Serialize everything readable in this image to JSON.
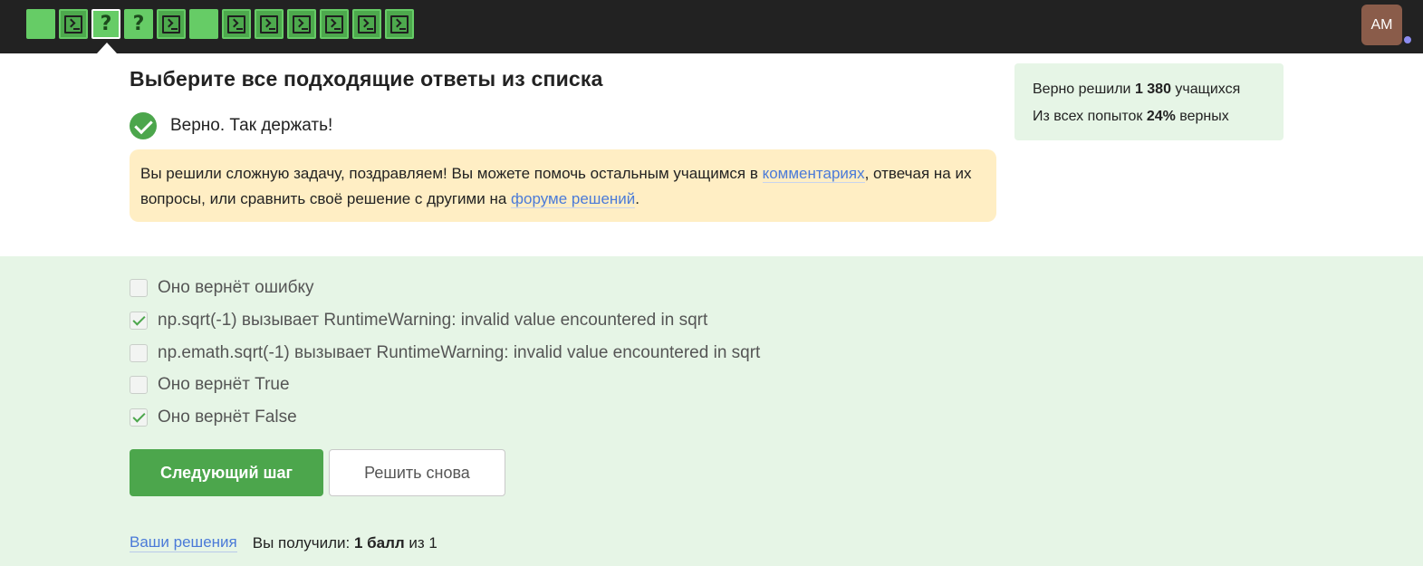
{
  "steps": [
    {
      "kind": "blank"
    },
    {
      "kind": "code"
    },
    {
      "kind": "quiz",
      "glyph": "?",
      "current": true
    },
    {
      "kind": "quiz",
      "glyph": "?"
    },
    {
      "kind": "code"
    },
    {
      "kind": "blank"
    },
    {
      "kind": "code"
    },
    {
      "kind": "code"
    },
    {
      "kind": "code"
    },
    {
      "kind": "code"
    },
    {
      "kind": "code"
    },
    {
      "kind": "code"
    }
  ],
  "user": {
    "initials": "AM",
    "avatar_color": "#8a5c4a",
    "status_color": "#8c8cf0"
  },
  "title": "Выберите все подходящие ответы из списка",
  "result": {
    "text": "Верно. Так держать!"
  },
  "notice": {
    "part1": "Вы решили сложную задачу, поздравляем! Вы можете помочь остальным учащимся в ",
    "link1": "комментариях",
    "part2": ", отвечая на их вопросы, или сравнить своё решение с другими на ",
    "link2": "форуме решений",
    "part3": "."
  },
  "stats": {
    "line1_prefix": "Верно решили ",
    "solved_count": "1 380",
    "line1_suffix": " учащихся",
    "line2_prefix": "Из всех попыток ",
    "percent": "24%",
    "line2_suffix": " верных"
  },
  "options": [
    {
      "label": "Оно вернёт ошибку",
      "checked": false
    },
    {
      "label": "np.sqrt(-1) вызывает RuntimeWarning: invalid value encountered in sqrt",
      "checked": true
    },
    {
      "label": "np.emath.sqrt(-1) вызывает RuntimeWarning: invalid value encountered in sqrt",
      "checked": false
    },
    {
      "label": "Оно вернёт True",
      "checked": false
    },
    {
      "label": "Оно вернёт False",
      "checked": true
    }
  ],
  "buttons": {
    "next": "Следующий шаг",
    "retry": "Решить снова"
  },
  "footer": {
    "solutions_link": "Ваши решения",
    "score_prefix": "Вы получили: ",
    "score_value": "1 балл",
    "score_suffix": " из 1"
  },
  "colors": {
    "accent": "#4ca64c",
    "step_green": "#66cc66",
    "topbar": "#222222",
    "link": "#4a7ad8",
    "notice_bg": "#ffeec4",
    "answers_bg": "#e6f5e6"
  }
}
